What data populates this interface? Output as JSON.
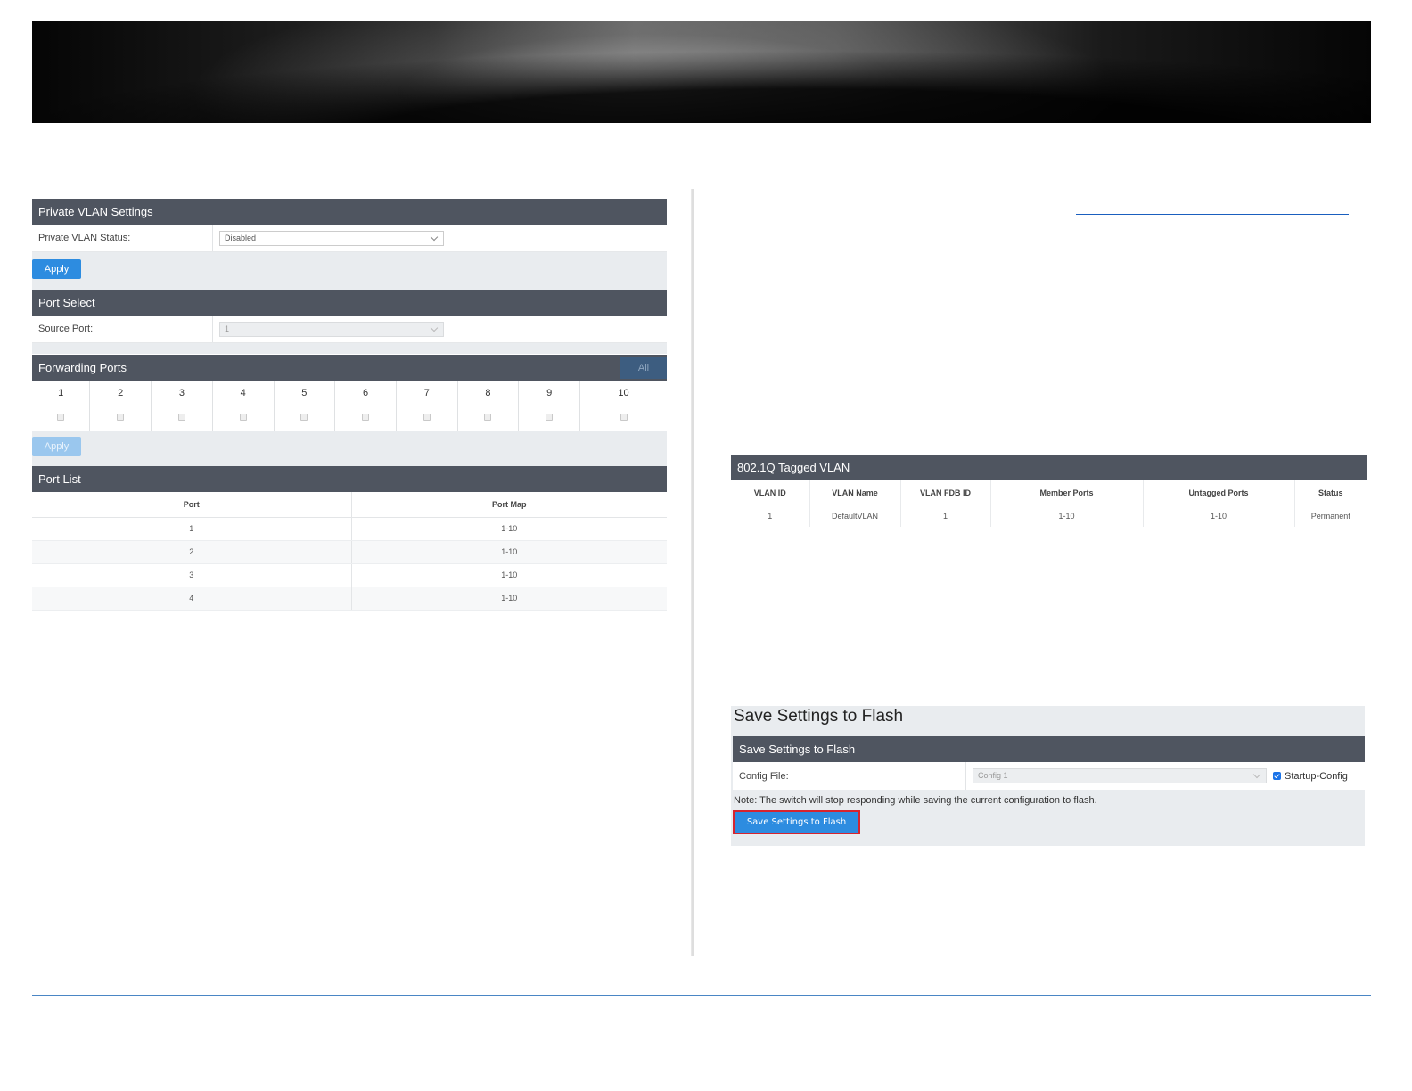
{
  "pvlan": {
    "header": "Private VLAN Settings",
    "status_label": "Private VLAN Status:",
    "status_value": "Disabled",
    "apply_label": "Apply"
  },
  "port_select": {
    "header": "Port Select",
    "source_label": "Source Port:",
    "source_value": "1"
  },
  "forwarding": {
    "header": "Forwarding Ports",
    "all_label": "All",
    "ports": [
      "1",
      "2",
      "3",
      "4",
      "5",
      "6",
      "7",
      "8",
      "9",
      "10"
    ],
    "apply_label": "Apply"
  },
  "port_list": {
    "header": "Port List",
    "columns": [
      "Port",
      "Port Map"
    ],
    "rows": [
      [
        "1",
        "1-10"
      ],
      [
        "2",
        "1-10"
      ],
      [
        "3",
        "1-10"
      ],
      [
        "4",
        "1-10"
      ]
    ]
  },
  "tagged_vlan": {
    "header": "802.1Q Tagged VLAN",
    "columns": [
      "VLAN ID",
      "VLAN Name",
      "VLAN FDB ID",
      "Member Ports",
      "Untagged Ports",
      "Status"
    ],
    "rows": [
      [
        "1",
        "DefaultVLAN",
        "1",
        "1-10",
        "1-10",
        "Permanent"
      ]
    ]
  },
  "save": {
    "title": "Save Settings to Flash",
    "header": "Save Settings to Flash",
    "config_label": "Config File:",
    "config_value": "Config 1",
    "startup_label": "Startup-Config",
    "note": "Note: The switch will stop responding while saving the current configuration to flash.",
    "button_label": "Save Settings to Flash"
  },
  "colors": {
    "header_bar": "#4f5560",
    "button": "#2d8ce0",
    "highlight_border": "#d6242f",
    "footer_line": "#4a86c5"
  }
}
